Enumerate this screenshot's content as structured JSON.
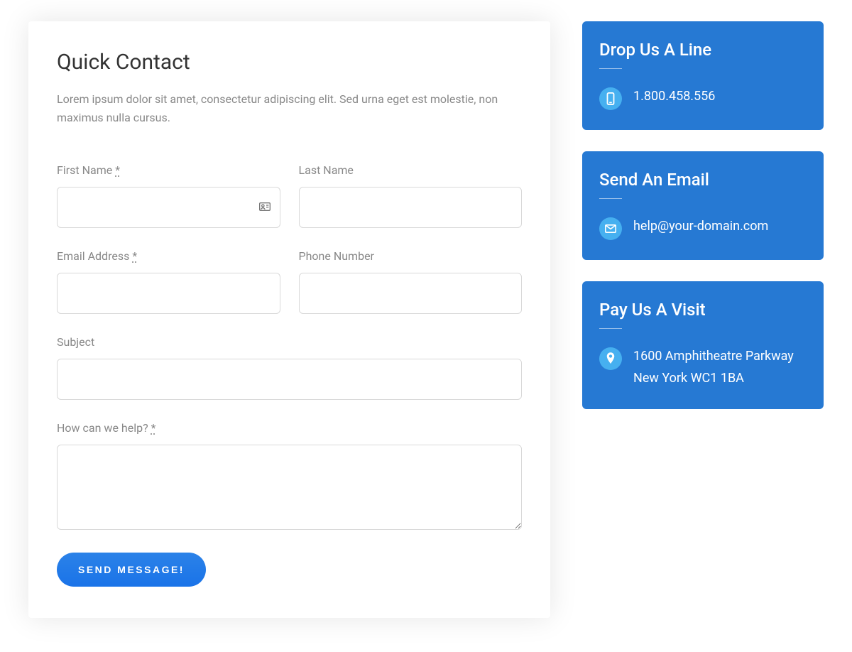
{
  "form": {
    "title": "Quick Contact",
    "description": "Lorem ipsum dolor sit amet, consectetur adipiscing elit. Sed urna eget est molestie, non maximus nulla cursus.",
    "fields": {
      "first_name": {
        "label": "First Name ",
        "required": "*",
        "value": ""
      },
      "last_name": {
        "label": "Last Name",
        "value": ""
      },
      "email": {
        "label": "Email Address ",
        "required": "*",
        "value": ""
      },
      "phone": {
        "label": "Phone Number",
        "value": ""
      },
      "subject": {
        "label": "Subject",
        "value": ""
      },
      "message": {
        "label": "How can we help? ",
        "required": "*",
        "value": ""
      }
    },
    "submit_label": "SEND MESSAGE!"
  },
  "sidebar": {
    "cards": [
      {
        "title": "Drop Us A Line",
        "icon": "mobile-icon",
        "text": "1.800.458.556"
      },
      {
        "title": "Send An Email",
        "icon": "envelope-icon",
        "text": "help@your-domain.com"
      },
      {
        "title": "Pay Us A Visit",
        "icon": "pin-icon",
        "text": "1600 Amphitheatre Parkway New York WC1 1BA"
      }
    ]
  }
}
